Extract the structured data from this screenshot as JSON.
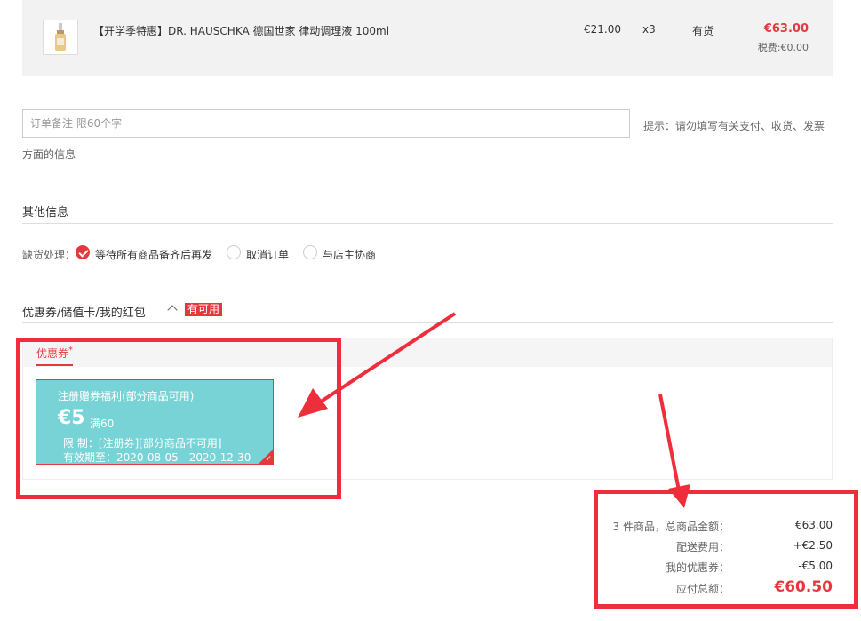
{
  "product": {
    "icon": "serum-bottle-icon",
    "name": "【开学季特惠】DR. HAUSCHKA 德国世家 律动调理液 100ml",
    "unit_price": "€21.00",
    "quantity": "x3",
    "stock": "有货",
    "total": "€63.00",
    "tax": "税费:€0.00"
  },
  "order_note": {
    "placeholder": "订单备注 限60个字",
    "value": "",
    "hint_line1": "提示：请勿填写有关支付、收货、发票",
    "hint_line2": "方面的信息"
  },
  "other_info": {
    "title": "其他信息",
    "oos_label": "缺货处理：",
    "options": [
      {
        "label": "等待所有商品备齐后再发",
        "selected": true
      },
      {
        "label": "取消订单",
        "selected": false
      },
      {
        "label": "与店主协商",
        "selected": false
      }
    ]
  },
  "coupon_section": {
    "title": "优惠券/储值卡/我的红包",
    "badge": "有可用",
    "tab": "优惠券",
    "tab_mark": "*",
    "card": {
      "title": "注册赠券福利(部分商品可用)",
      "amount": "€5",
      "min_spend": "满60",
      "limit": "限 制：[注册券][部分商品不可用]",
      "validity": "有效期至：2020-08-05 - 2020-12-30",
      "selected": true,
      "color": "#78d3d6"
    }
  },
  "summary": {
    "items_label": "3 件商品，总商品金额：",
    "items_value": "€63.00",
    "shipping_label": "配送费用：",
    "shipping_value": "+€2.50",
    "coupon_label": "我的优惠券：",
    "coupon_value": "-€5.00",
    "total_label": "应付总额：",
    "total_value": "€60.50"
  },
  "colors": {
    "accent": "#e4393c",
    "annotation": "#ee2e3a"
  }
}
